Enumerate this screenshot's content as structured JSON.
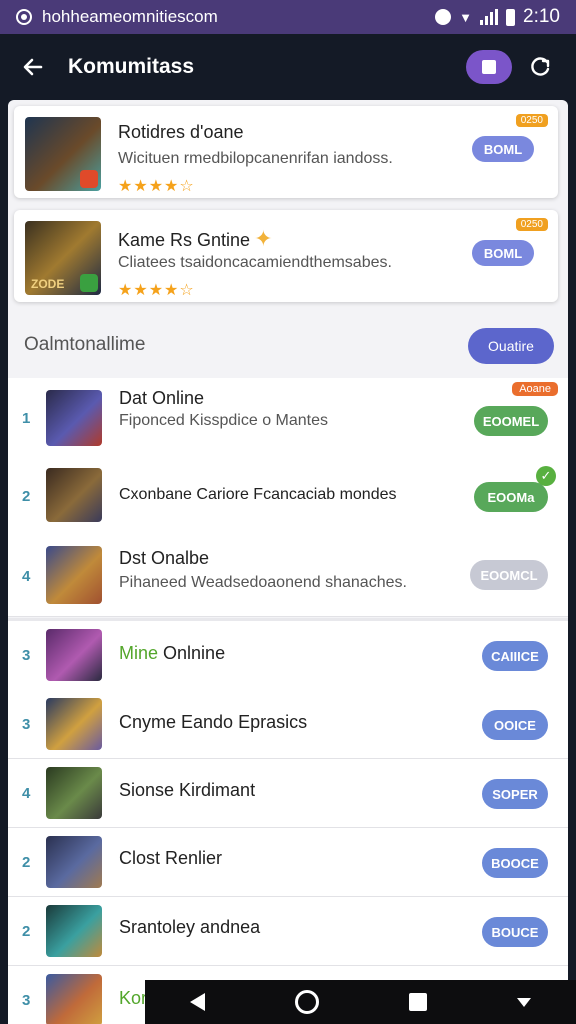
{
  "status_bar": {
    "url_text": "hohheameomnitiescom",
    "time": "2:10"
  },
  "app_bar": {
    "title": "Komumitass",
    "back_icon": "arrow-left-icon",
    "action_icon": "square-icon",
    "refresh_icon": "refresh-icon"
  },
  "featured": [
    {
      "title": "Rotidres d'oane",
      "description": "Wicituen rmedbilopcanenrifan iandoss.",
      "stars": 4.5,
      "corner_tag": "0250",
      "button": "BOML",
      "thumb_colors": [
        "#1f3550",
        "#6a4a2a",
        "#4aa0a0"
      ],
      "badge_color": "#e04a2a"
    },
    {
      "title": "Kame Rs Gntine",
      "description": "Cliatees tsaidoncacamiendthemsabes.",
      "stars": 4.5,
      "corner_tag": "0250",
      "button": "BOML",
      "thumb_colors": [
        "#3a3020",
        "#a07a30",
        "#1e2a44"
      ],
      "badge_color": "#3aa040",
      "thumb_caption": "ZODE"
    }
  ],
  "section": {
    "heading": "Oalmtonallime",
    "button": "Ouatire"
  },
  "list": [
    {
      "rank": "1",
      "title": "Dat Online",
      "title_highlight": "",
      "description": "Fiponced Kisspdice o Mantes",
      "button": "EOOMEL",
      "button_style": "green",
      "tag": "Aoane",
      "check": false,
      "thumb_colors": [
        "#2a2a4a",
        "#5a5ab0",
        "#b03a2a"
      ]
    },
    {
      "rank": "2",
      "title": "Cxonbane Cariore Fcancaciab mondes",
      "title_highlight": "",
      "description": "",
      "button": "EOOMa",
      "button_style": "green",
      "tag": "",
      "check": true,
      "thumb_colors": [
        "#3a2a20",
        "#8a6a3a",
        "#3a3a5a"
      ]
    },
    {
      "rank": "4",
      "title": "Dst Onalbe",
      "title_highlight": "",
      "description": "Pihaneed Weadsedoaonend shanaches.",
      "button": "EOOMCL",
      "button_style": "grey",
      "tag": "",
      "check": false,
      "thumb_colors": [
        "#3a4a8a",
        "#c08a3a",
        "#a05030"
      ]
    },
    {
      "rank": "3",
      "title": "Onlnine",
      "title_highlight": "Mine",
      "description": "",
      "button": "CAIIICE",
      "button_style": "blue",
      "tag": "",
      "check": false,
      "thumb_colors": [
        "#5a2a6a",
        "#b05ab0",
        "#2a2a40"
      ]
    },
    {
      "rank": "3",
      "title": "Cnyme Eando Eprasics",
      "title_highlight": "",
      "description": "",
      "button": "OOICE",
      "button_style": "blue",
      "tag": "",
      "check": false,
      "thumb_colors": [
        "#2a3a60",
        "#d0a040",
        "#6a5aa0"
      ]
    },
    {
      "rank": "4",
      "title": "Sionse Kirdimant",
      "title_highlight": "",
      "description": "",
      "button": "SOPER",
      "button_style": "blue",
      "tag": "",
      "check": false,
      "thumb_colors": [
        "#2a3a20",
        "#6a8a4a",
        "#3a3a3a"
      ]
    },
    {
      "rank": "2",
      "title": "Clost Renlier",
      "title_highlight": "",
      "description": "",
      "button": "BOOCE",
      "button_style": "blue",
      "tag": "",
      "check": false,
      "thumb_colors": [
        "#2a3050",
        "#5a6aa0",
        "#a07a50"
      ]
    },
    {
      "rank": "2",
      "title": "Srantoley andnea",
      "title_highlight": "",
      "description": "",
      "button": "BOUCE",
      "button_style": "blue",
      "tag": "",
      "check": false,
      "thumb_colors": [
        "#1a3a3a",
        "#3aa0a0",
        "#c08a3a"
      ]
    },
    {
      "rank": "3",
      "title": "Kor",
      "title_highlight": "",
      "description": "",
      "button": "",
      "button_style": "blue",
      "tag": "",
      "check": false,
      "thumb_colors": [
        "#3a5aa0",
        "#c06a3a",
        "#d0a040"
      ]
    }
  ],
  "nav_bar": {
    "icons": [
      "back-triangle-icon",
      "home-circle-icon",
      "recents-square-icon",
      "more-down-icon"
    ]
  },
  "colors": {
    "status_bar": "#4a3a78",
    "app_bar": "#141a26",
    "accent_purple": "#7b55c9",
    "button_blue": "#6a89d8",
    "button_green": "#58a85a",
    "rank_teal": "#3f8fa8",
    "star_orange": "#f5a21b"
  }
}
